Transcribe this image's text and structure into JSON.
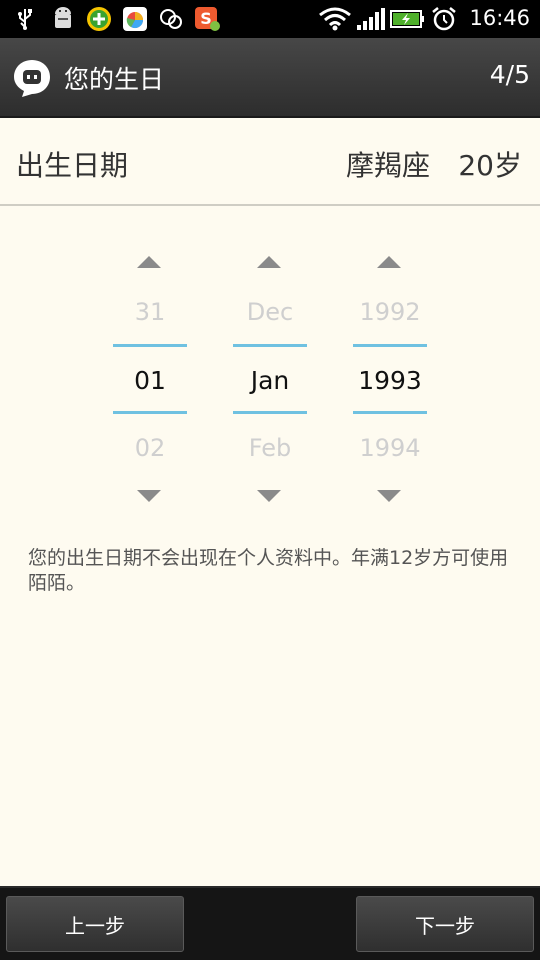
{
  "status_bar": {
    "time": "16:46",
    "icons": [
      "usb-icon",
      "android-debug-icon",
      "green-app-icon",
      "photo-app-icon",
      "chat-app-icon",
      "sogou-input-icon",
      "wifi-icon",
      "signal-icon",
      "battery-charging-icon",
      "alarm-icon"
    ]
  },
  "titlebar": {
    "title": "您的生日",
    "step": "4/5",
    "app_icon": "chat-bubble-icon"
  },
  "header": {
    "label": "出生日期",
    "zodiac": "摩羯座",
    "age": "20岁"
  },
  "picker": {
    "day": {
      "prev": "31",
      "current": "01",
      "next": "02"
    },
    "month": {
      "prev": "Dec",
      "current": "Jan",
      "next": "Feb"
    },
    "year": {
      "prev": "1992",
      "current": "1993",
      "next": "1994"
    }
  },
  "note": "您的出生日期不会出现在个人资料中。年满12岁方可使用陌陌。",
  "buttons": {
    "prev": "上一步",
    "next": "下一步"
  },
  "colors": {
    "background": "#fefbf0",
    "selection_line": "#6fc1e1",
    "titlebar": "#3a3a3a"
  }
}
